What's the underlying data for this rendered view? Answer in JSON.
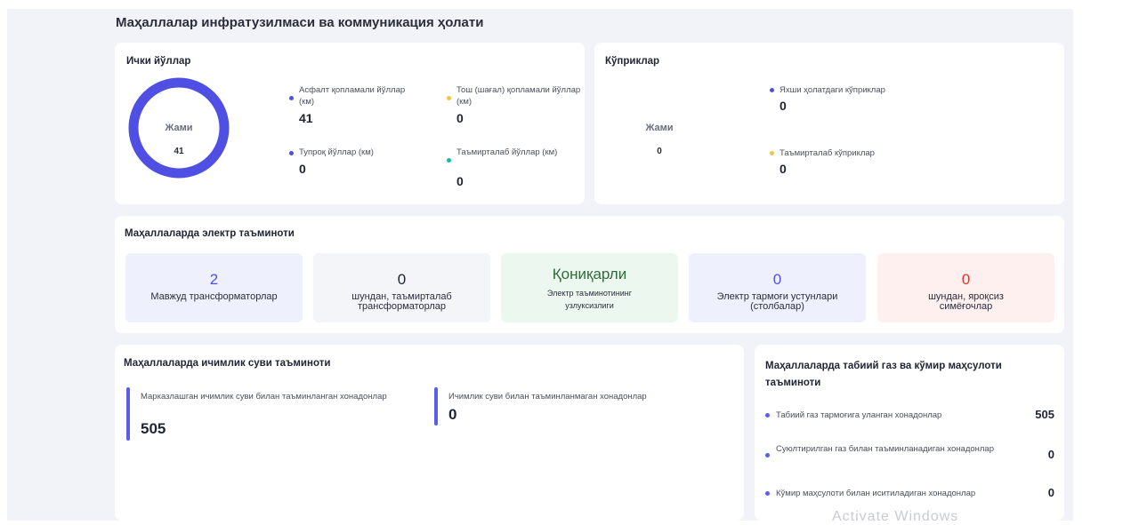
{
  "page_title": "Маҳаллалар инфратузилмаси ва коммуникация ҳолати",
  "colors": {
    "primary": "#4f50e3",
    "yellow": "#f4c542",
    "teal": "#18b9a6",
    "red": "#e0362f",
    "green_text": "#2f6b3a"
  },
  "roads": {
    "title": "Ички йўллар",
    "donut_label": "Жами",
    "donut_value": "41",
    "stats": [
      {
        "label": "Асфалт қопламали йўллар (км)",
        "value": "41",
        "color": "#4f50e3"
      },
      {
        "label": "Тош (шағал) қопламали йўллар (км)",
        "value": "0",
        "color": "#f4c542"
      },
      {
        "label": "Тупроқ йўллар (км)",
        "value": "0",
        "color": "#4f50e3"
      },
      {
        "label": "Таъмирталаб йўллар (км)",
        "value": "0",
        "color": "#18b9a6"
      }
    ]
  },
  "bridges": {
    "title": "Кўприклар",
    "total_label": "Жами",
    "total_value": "0",
    "stats": [
      {
        "label": "Яхши ҳолатдаги кўприклар",
        "value": "0",
        "color": "#4f50e3"
      },
      {
        "label": "Таъмирталаб кўприклар",
        "value": "0",
        "color": "#f4c542"
      }
    ]
  },
  "electric": {
    "title": "Маҳаллаларда электр таъминоти",
    "tiles": [
      {
        "value": "2",
        "label": "Мавжуд трансформаторлар"
      },
      {
        "value": "0",
        "label": "шундан, таъмирталаб трансформаторлар"
      },
      {
        "value": "Қониқарли",
        "label": "Электр таъминотининг узлуксизлиги"
      },
      {
        "value": "0",
        "label": "Электр тармоғи устунлари (столбалар)"
      },
      {
        "value": "0",
        "label": "шундан, яроқсиз симёғочлар"
      }
    ]
  },
  "water": {
    "title": "Маҳаллаларда ичимлик суви таъминоти",
    "stats": [
      {
        "label": "Марказлашган ичимлик суви билан таъминланган хонадонлар",
        "value": "505"
      },
      {
        "label": "Ичимлик суви билан таъминланмаган хонадонлар",
        "value": "0"
      }
    ]
  },
  "gas": {
    "title": "Маҳаллаларда табиий газ ва кўмир маҳсулоти таъминоти",
    "rows": [
      {
        "label": "Табиий газ тармоғига уланган хонадонлар",
        "value": "505"
      },
      {
        "label": "Суюлтирилган газ билан таъминланадиган хонадонлар",
        "value": "0"
      },
      {
        "label": "Кўмир маҳсулоти билан иситиладиган хонадонлар",
        "value": "0"
      }
    ]
  },
  "watermark": "Activate Windows"
}
